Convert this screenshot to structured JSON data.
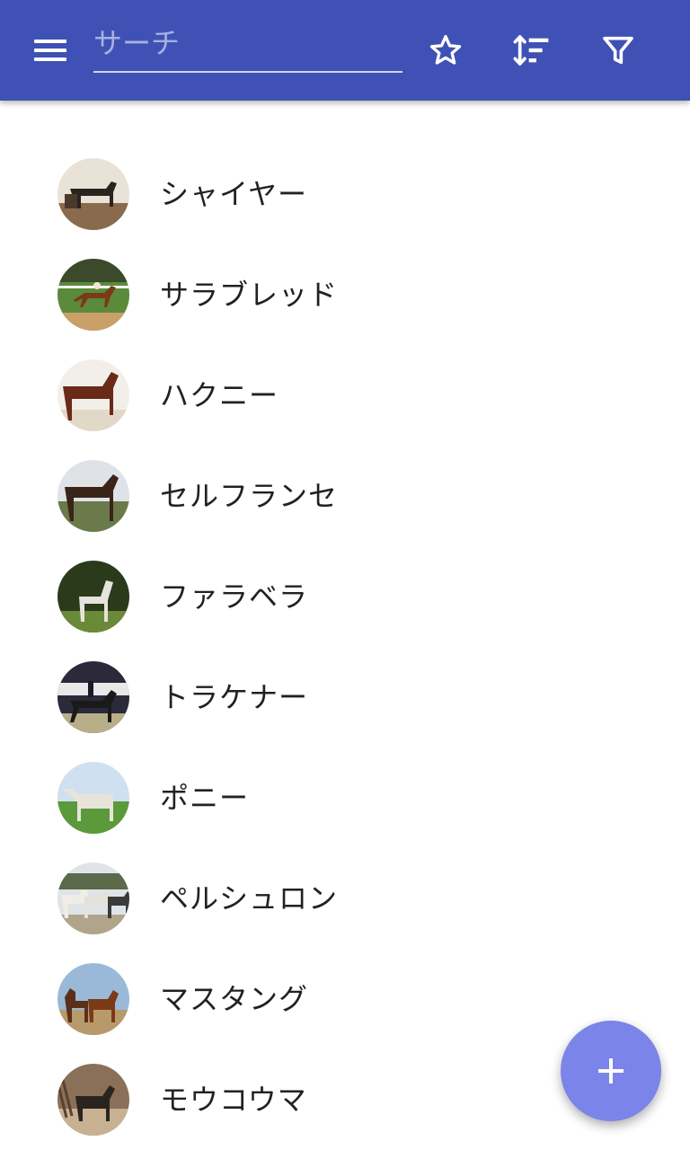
{
  "appbar": {
    "background": "#3f51b5",
    "menu_icon": "hamburger-menu-icon",
    "search": {
      "placeholder": "サーチ",
      "value": ""
    },
    "actions": [
      {
        "icon": "star-outline-icon"
      },
      {
        "icon": "sort-icon"
      },
      {
        "icon": "filter-icon"
      }
    ]
  },
  "list": {
    "items": [
      {
        "label": "シャイヤー",
        "avatar_icon": "horse-photo"
      },
      {
        "label": "サラブレッド",
        "avatar_icon": "horse-photo"
      },
      {
        "label": "ハクニー",
        "avatar_icon": "horse-photo"
      },
      {
        "label": "セルフランセ",
        "avatar_icon": "horse-photo"
      },
      {
        "label": "ファラベラ",
        "avatar_icon": "horse-photo"
      },
      {
        "label": "トラケナー",
        "avatar_icon": "horse-photo"
      },
      {
        "label": "ポニー",
        "avatar_icon": "horse-photo"
      },
      {
        "label": "ペルシュロン",
        "avatar_icon": "horse-photo"
      },
      {
        "label": "マスタング",
        "avatar_icon": "horse-photo"
      },
      {
        "label": "モウコウマ",
        "avatar_icon": "horse-photo"
      }
    ]
  },
  "fab": {
    "icon": "plus-icon",
    "color": "#7b84e8"
  }
}
